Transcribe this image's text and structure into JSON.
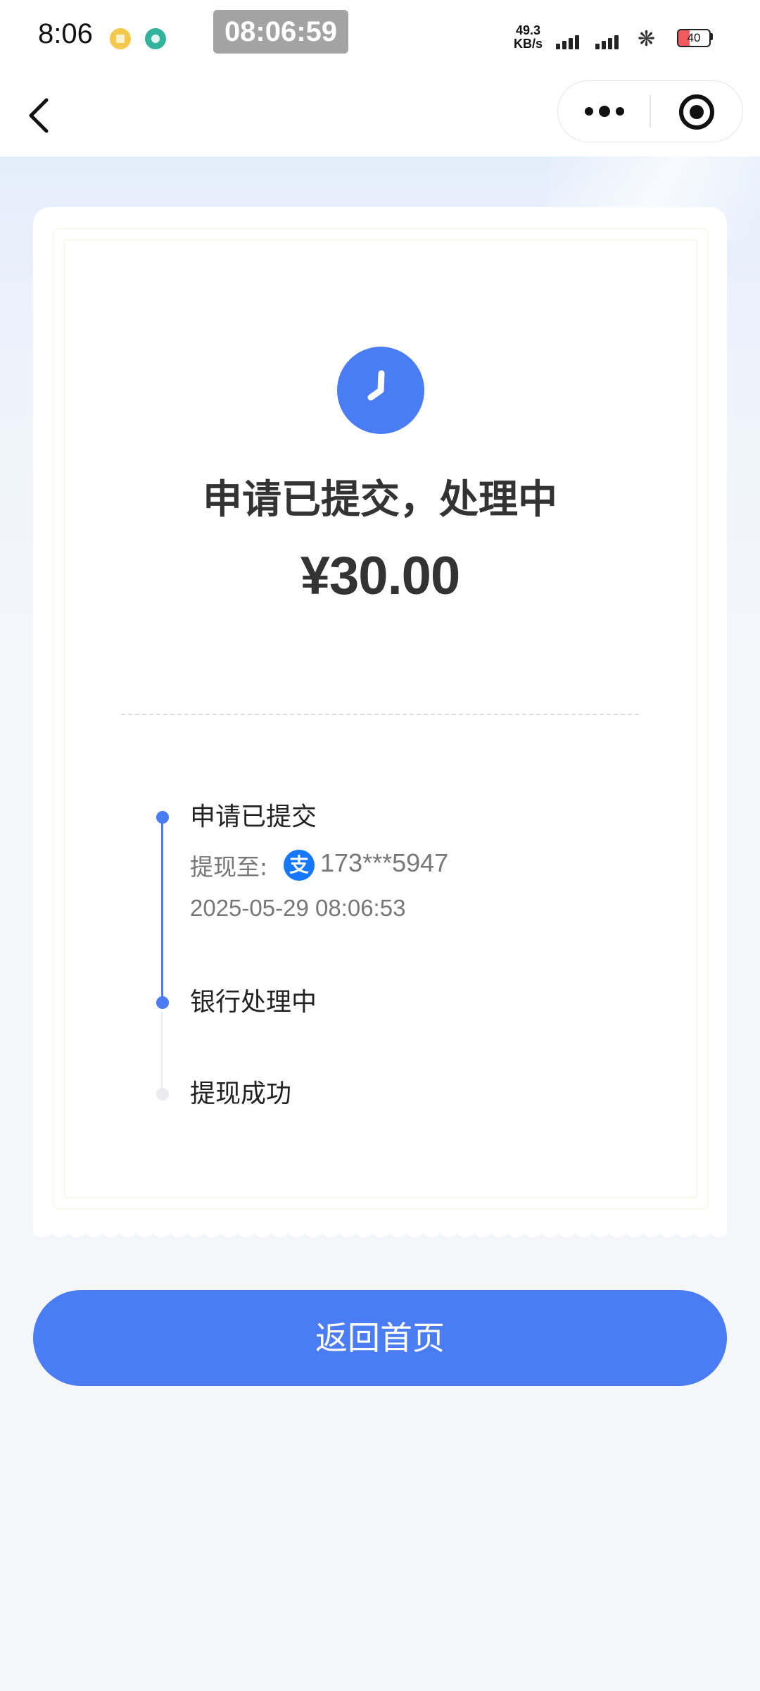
{
  "status_bar": {
    "time": "8:06",
    "clock_overlay": "08:06:59",
    "net_speed_value": "49.3",
    "net_speed_unit": "KB/s",
    "battery": "40"
  },
  "result": {
    "title": "申请已提交，处理中",
    "amount": "¥30.00"
  },
  "timeline": {
    "steps": [
      {
        "label": "申请已提交",
        "withdraw_to_label": "提现至:",
        "account": "173***5947",
        "datetime": "2025-05-29 08:06:53",
        "done": true
      },
      {
        "label": "银行处理中",
        "done": true
      },
      {
        "label": "提现成功",
        "done": false
      }
    ]
  },
  "actions": {
    "home_button": "返回首页"
  },
  "icons": {
    "status": "clock-icon",
    "account_provider": "alipay-icon",
    "alipay_glyph": "支",
    "back": "back-arrow-icon",
    "more": "more-dots-icon",
    "close": "miniprogram-close-icon"
  },
  "colors": {
    "accent": "#4a7cf5",
    "alipay": "#1677ff",
    "background": "#f4f6fa",
    "card": "#ffffff"
  }
}
